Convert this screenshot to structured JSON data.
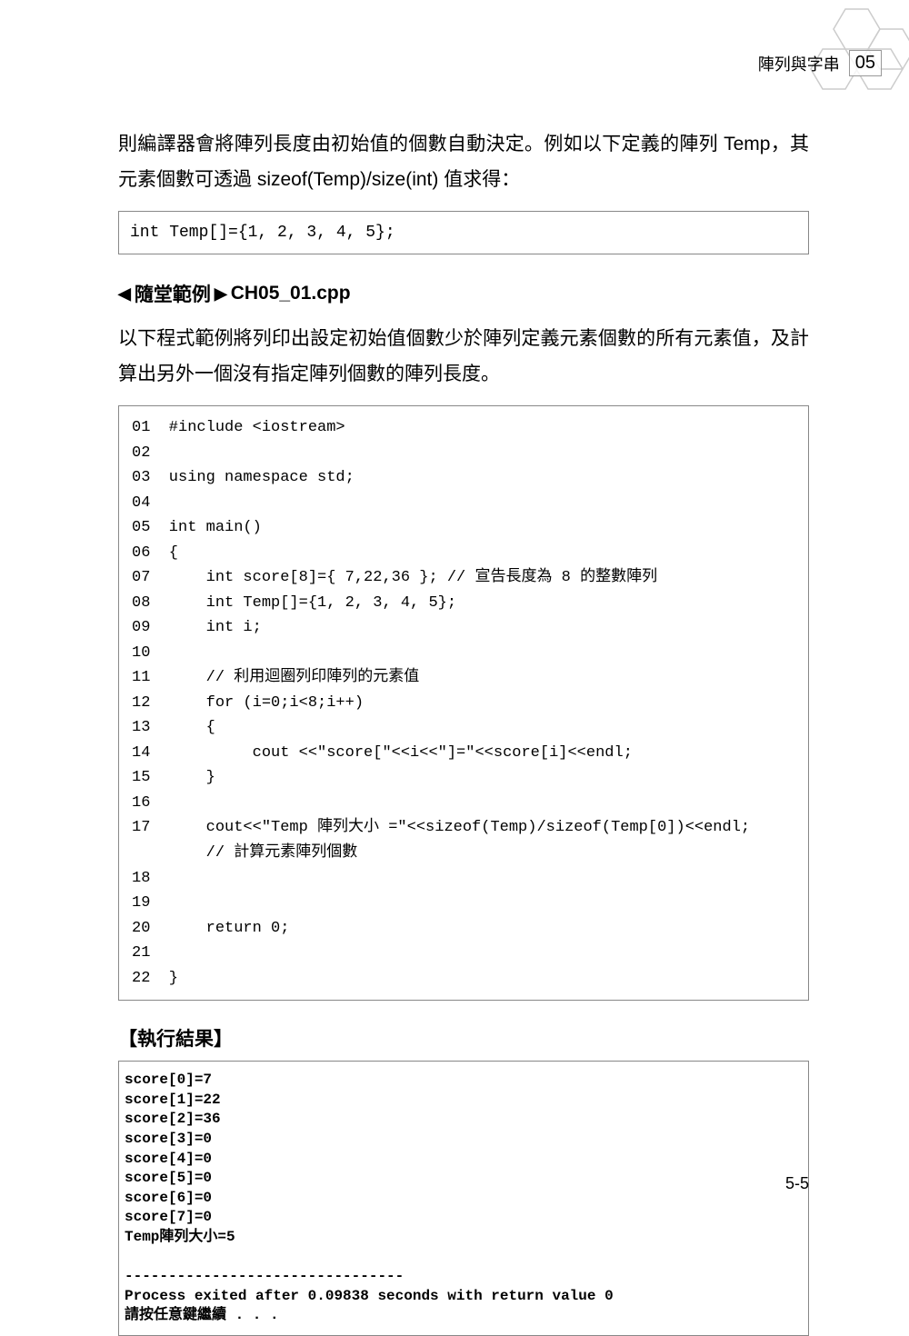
{
  "header": {
    "title": "陣列與字串",
    "chapter": "05"
  },
  "para1": "則編譯器會將陣列長度由初始值的個數自動決定。例如以下定義的陣列 Temp，其元素個數可透過 sizeof(Temp)/size(int) 值求得：",
  "code1": "int Temp[]={1, 2, 3, 4, 5};",
  "section": {
    "label_left": "◀",
    "label_text": "隨堂範例",
    "label_right": "▶",
    "filename": "CH05_01.cpp"
  },
  "para2": "以下程式範例將列印出設定初始值個數少於陣列定義元素個數的所有元素值，及計算出另外一個沒有指定陣列個數的陣列長度。",
  "listing": "01  #include <iostream>\n02\n03  using namespace std;\n04\n05  int main()\n06  {\n07      int score[8]={ 7,22,36 }; // 宣告長度為 8 的整數陣列\n08      int Temp[]={1, 2, 3, 4, 5};\n09      int i;\n10\n11      // 利用迴圈列印陣列的元素值\n12      for (i=0;i<8;i++)\n13      {\n14           cout <<\"score[\"<<i<<\"]=\"<<score[i]<<endl;\n15      }\n16\n17      cout<<\"Temp 陣列大小 =\"<<sizeof(Temp)/sizeof(Temp[0])<<endl;\n        // 計算元素陣列個數\n18\n19\n20      return 0;\n21\n22  }",
  "result_title": "【執行結果】",
  "result": "score[0]=7\nscore[1]=22\nscore[2]=36\nscore[3]=0\nscore[4]=0\nscore[5]=0\nscore[6]=0\nscore[7]=0\nTemp陣列大小=5\n\n--------------------------------\nProcess exited after 0.09838 seconds with return value 0\n請按任意鍵繼續 . . .",
  "page_number": "5-5"
}
